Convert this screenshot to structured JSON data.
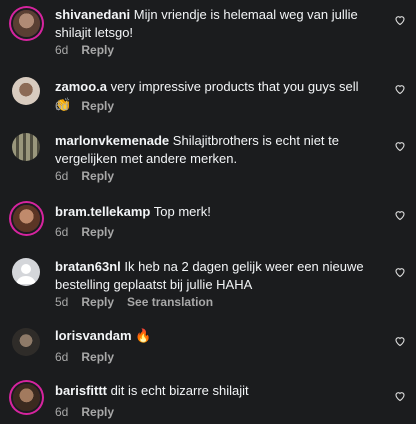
{
  "comments": [
    {
      "username": "shivanedani",
      "text": "Mijn vriendje is helemaal weg van jullie shilajit letsgo!",
      "age": "6d",
      "reply_label": "Reply",
      "avatar_color": "#7a5a4a"
    },
    {
      "username": "zamoo.a",
      "text": "very impressive products that you guys sell",
      "emoji": "👏",
      "age": "6d",
      "reply_label": "Reply",
      "avatar_color": "#c9b8a8"
    },
    {
      "username": "marlonvkemenade",
      "text": "Shilajitbrothers is echt niet te vergelijken met andere merken.",
      "age": "6d",
      "reply_label": "Reply",
      "avatar_color": "#6b6a58"
    },
    {
      "username": "bram.tellekamp",
      "text": "Top merk!",
      "age": "6d",
      "reply_label": "Reply",
      "avatar_color": "#8a5540"
    },
    {
      "username": "bratan63nl",
      "text": "Ik heb na 2 dagen gelijk weer een nieuwe bestelling geplaatst bij jullie HAHA",
      "age": "5d",
      "reply_label": "Reply",
      "translate_label": "See translation",
      "avatar_color": "#d4d6da"
    },
    {
      "username": "lorisvandam",
      "text": "",
      "emoji": "🔥",
      "age": "6d",
      "reply_label": "Reply",
      "avatar_color": "#4e4a44"
    },
    {
      "username": "barisfittt",
      "text": "dit is echt bizarre shilajit",
      "age": "6d",
      "reply_label": "Reply",
      "avatar_color": "#7b5a40"
    }
  ],
  "theme": {
    "background": "#1b1c1e",
    "text": "#f3f5f7",
    "muted": "#a8a8a8",
    "story_ring": "#d6249f"
  }
}
